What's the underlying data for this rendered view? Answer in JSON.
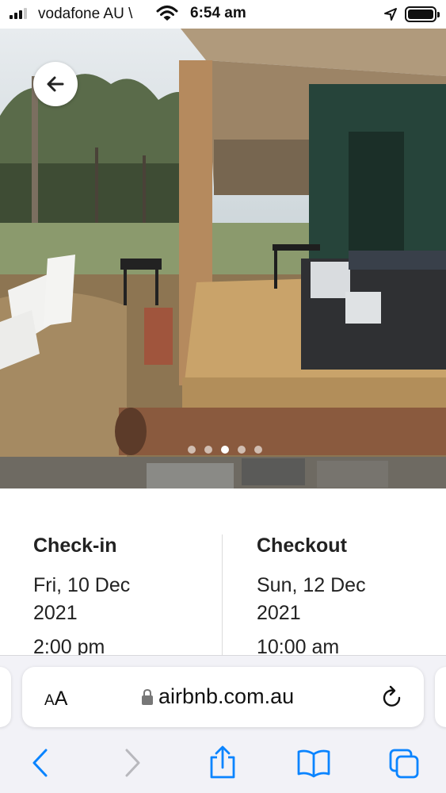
{
  "status_bar": {
    "carrier": "vodafone AU \\",
    "time": "6:54 am"
  },
  "hero": {
    "photo_count": 5,
    "active_photo_index": 2,
    "back_icon": "arrow-left-icon"
  },
  "booking": {
    "checkin": {
      "label": "Check-in",
      "date": "Fri, 10 Dec 2021",
      "time": "2:00 pm"
    },
    "checkout": {
      "label": "Checkout",
      "date": "Sun, 12 Dec 2021",
      "time": "10:00 am"
    }
  },
  "safari": {
    "aa_small": "A",
    "aa_big": "A",
    "url": "airbnb.com.au",
    "toolbar": [
      "back-icon",
      "forward-icon",
      "share-icon",
      "bookmarks-icon",
      "tabs-icon"
    ]
  },
  "colors": {
    "accent_blue": "#0a84ff",
    "disabled_gray": "#b8b8bd"
  }
}
